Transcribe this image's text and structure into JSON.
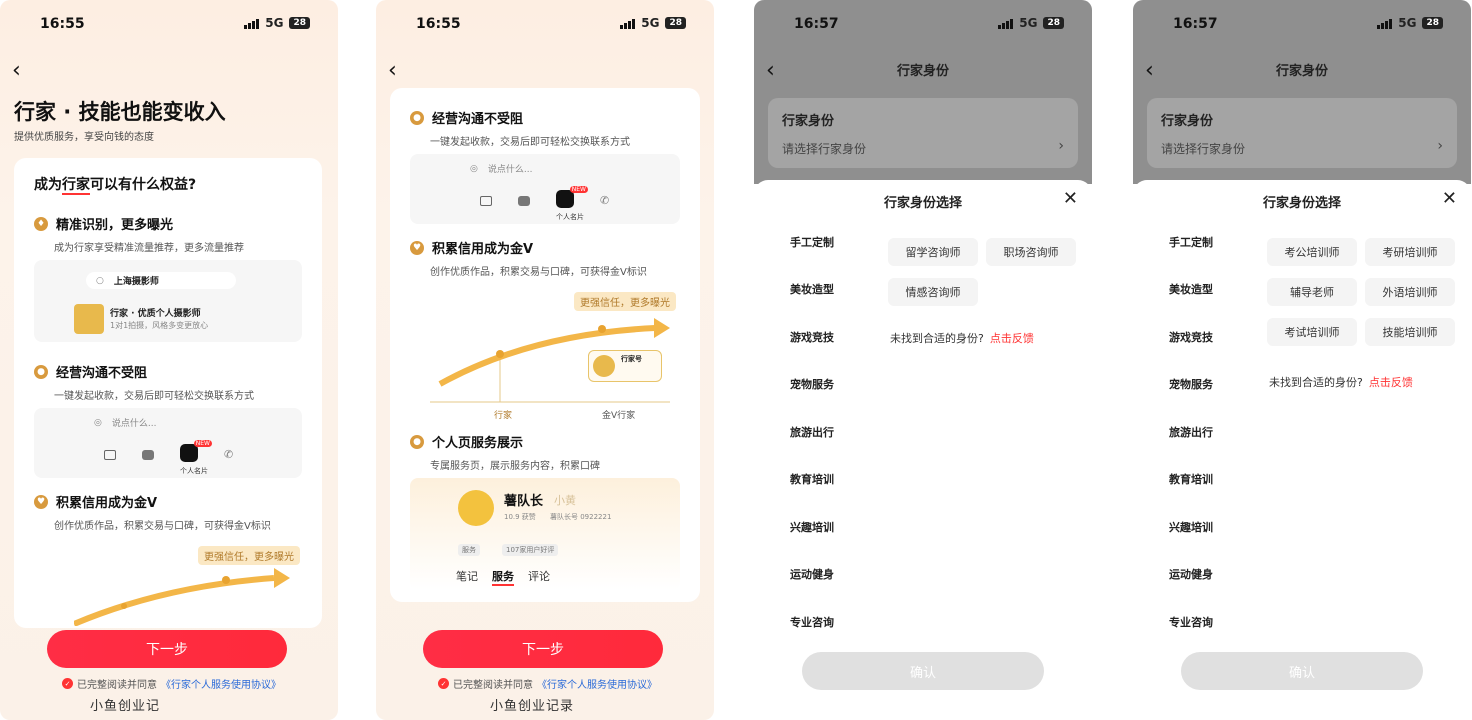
{
  "status": {
    "time1": "16:55",
    "time2": "16:55",
    "time3": "16:57",
    "time4": "16:57",
    "net": "5G",
    "battery": "28"
  },
  "panel1": {
    "title": "行家 · 技能也能变收入",
    "subtitle": "提供优质服务，享受向钱的态度",
    "question_pre": "成为",
    "question_hl": "行家",
    "question_post": "可以有什么权益?",
    "s1_title": "精准识别，更多曝光",
    "s1_desc": "成为行家享受精准流量推荐，更多流量推荐",
    "mock1_search": "上海摄影师",
    "mock1_name": "行家 · 优质个人摄影师",
    "mock1_desc": "1对1拍摄，风格多变更放心",
    "s2_title": "经营沟通不受阻",
    "s2_desc": "一键发起收款，交易后即可轻松交换联系方式",
    "mock2_input": "说点什么...",
    "mock2_card": "个人名片",
    "s3_title": "积累信用成为金V",
    "s3_desc": "创作优质作品，积累交易与口碑，可获得金V标识",
    "strong_label": "更强信任，更多曝光",
    "next": "下一步",
    "agree_pre": "已完整阅读并同意",
    "agree_link": "《行家个人服务使用协议》",
    "watermark": "小鱼创业记"
  },
  "panel2": {
    "s2_title": "经营沟通不受阻",
    "s2_desc": "一键发起收款，交易后即可轻松交换联系方式",
    "mock2_input": "说点什么...",
    "mock2_card": "个人名片",
    "s3_title": "积累信用成为金V",
    "s3_desc": "创作优质作品，积累交易与口碑，可获得金V标识",
    "strong_label": "更强信任，更多曝光",
    "axis_a": "行家",
    "axis_b": "金V行家",
    "mini_name": "行家号",
    "s4_title": "个人页服务展示",
    "s4_desc": "专属服务页，展示服务内容，积累口碑",
    "profile_name": "薯队长",
    "profile_alias": "小黄",
    "profile_meta1": "10.9 获赞",
    "profile_meta2": "薯队长号 0922221",
    "tag1": "服务",
    "tag2": "107家用户好评",
    "tabs": [
      "笔记",
      "服务",
      "评论"
    ],
    "next": "下一步",
    "agree_pre": "已完整阅读并同意",
    "agree_link": "《行家个人服务使用协议》",
    "watermark": "小鱼创业记录"
  },
  "panel3": {
    "nav_title": "行家身份",
    "field_label": "行家身份",
    "field_placeholder": "请选择行家身份",
    "sheet_title": "行家身份选择",
    "categories": [
      "手工定制",
      "美妆造型",
      "游戏竞技",
      "宠物服务",
      "旅游出行",
      "教育培训",
      "兴趣培训",
      "运动健身",
      "专业咨询"
    ],
    "options": [
      "留学咨询师",
      "职场咨询师",
      "情感咨询师"
    ],
    "notfound": "未找到合适的身份?",
    "feedback": "点击反馈",
    "confirm": "确认"
  },
  "panel4": {
    "nav_title": "行家身份",
    "field_label": "行家身份",
    "field_placeholder": "请选择行家身份",
    "sheet_title": "行家身份选择",
    "categories": [
      "手工定制",
      "美妆造型",
      "游戏竞技",
      "宠物服务",
      "旅游出行",
      "教育培训",
      "兴趣培训",
      "运动健身",
      "专业咨询"
    ],
    "options": [
      "考公培训师",
      "考研培训师",
      "辅导老师",
      "外语培训师",
      "考试培训师",
      "技能培训师"
    ],
    "notfound": "未找到合适的身份?",
    "feedback": "点击反馈",
    "confirm": "确认"
  }
}
